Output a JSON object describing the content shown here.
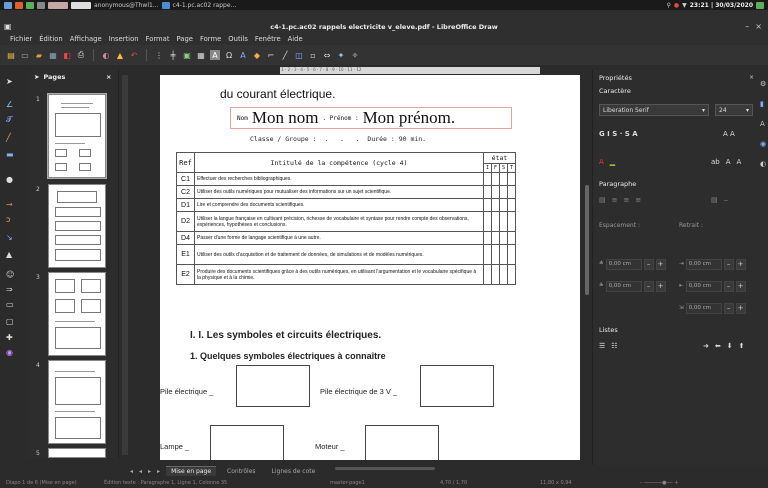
{
  "system": {
    "user_task": "anonymous@Thwl1...",
    "doc_task": "c4-1.pc.ac02 rappe...",
    "clock": "23:21 | 30/03/2020"
  },
  "window": {
    "title": "c4-1.pc.ac02 rappels electricite v_eleve.pdf - LibreOffice Draw",
    "min_label": "–",
    "close_label": "×"
  },
  "menu": [
    "Fichier",
    "Édition",
    "Affichage",
    "Insertion",
    "Format",
    "Page",
    "Forme",
    "Outils",
    "Fenêtre",
    "Aide"
  ],
  "pages_pane": {
    "title": "Pages",
    "close": "×",
    "thumb_numbers": [
      "1",
      "2",
      "3",
      "4",
      "5"
    ]
  },
  "document": {
    "heading_partial": "du courant électrique.",
    "nom_label": "Nom",
    "nom_value": "Mon nom",
    "prenom_label": ". Prénom :",
    "prenom_value": "Mon prénom.",
    "classe_line": "Classe / Groupe :  .   .   .  Durée : 90 min.",
    "table": {
      "header_ref": "Ref",
      "header_title": "Intitulé de la compétence (cycle 4)",
      "header_etat": "état",
      "etat_cols": [
        "I",
        "F",
        "S",
        "T"
      ],
      "rows": [
        {
          "ref": "C1",
          "text": "Effectuer des recherches bibliographiques."
        },
        {
          "ref": "C2",
          "text": "Utiliser des outils numériques pour mutualiser des informations sur un sujet scientifique."
        },
        {
          "ref": "D1",
          "text": "Lire et comprendre des documents scientifiques."
        },
        {
          "ref": "D2",
          "text": "Utiliser la langue française en cultivant précision, richesse de vocabulaire et syntaxe pour rendre compte des observations, expériences, hypothèses et conclusions."
        },
        {
          "ref": "D4",
          "text": "Passer d'une forme de langage scientifique à une autre."
        },
        {
          "ref": "E1",
          "text": "Utiliser des outils d'acquisition et de traitement de données, de simulations et de modèles numériques."
        },
        {
          "ref": "E2",
          "text": "Produire des documents scientifiques grâce à des outils numériques, en utilisant l'argumentation et le vocabulaire spécifique à la physique et à la chimie."
        }
      ]
    },
    "section1": "I.  I.    Les symboles et circuits électriques.",
    "section2": "1.  Quelques symboles électriques à connaître",
    "labels": {
      "pile": "Pile électrique _",
      "pile3v": "Pile électrique de 3 V _",
      "lampe": "Lampe _",
      "moteur": "Moteur _"
    }
  },
  "tabs": [
    "Mise en page",
    "Contrôles",
    "Lignes de cote"
  ],
  "properties": {
    "title": "Propriétés",
    "caractere": "Caractère",
    "font_name": "Liberation Serif",
    "font_size": "24",
    "style_buttons": "G  I  S  · S  A",
    "size_buttons": "A  A",
    "paragraphe": "Paragraphe",
    "espacement": "Espacement :",
    "retrait": "Retrait :",
    "spin_value": "0,00 cm",
    "listes": "Listes"
  },
  "status": {
    "diapo": "Diapo 1 de 6 (Mise en page)",
    "edition": "Édition texte : Paragraphe 1, Ligne 1, Colonne 35",
    "master": "master-page1",
    "pos": "4,70 / 1,70",
    "size": "11,80 x 0,94"
  }
}
